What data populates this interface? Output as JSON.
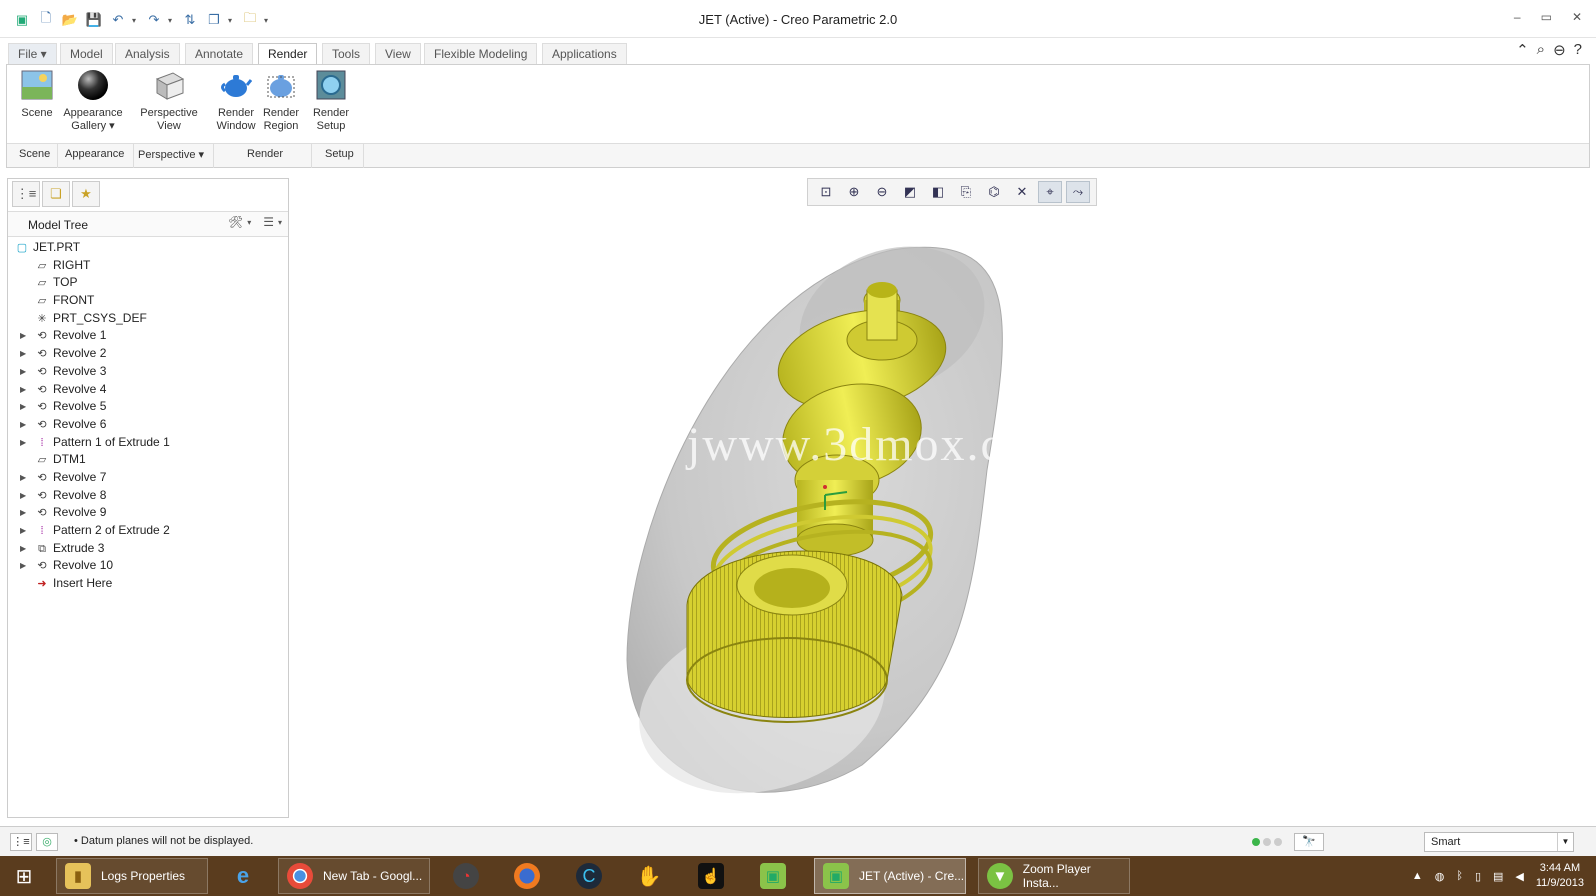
{
  "window": {
    "title": "JET (Active) - Creo Parametric 2.0",
    "controls": [
      "–",
      "▭",
      "✕"
    ]
  },
  "quick_access": {
    "icons": [
      "app-icon",
      "new-icon",
      "open-icon",
      "save-icon",
      "undo-icon",
      "redo-icon",
      "regenerate-icon",
      "windows-icon",
      "close-window-icon",
      "customize-icon"
    ]
  },
  "tabs": [
    {
      "label": "File ▾"
    },
    {
      "label": "Model"
    },
    {
      "label": "Analysis"
    },
    {
      "label": "Annotate"
    },
    {
      "label": "Render"
    },
    {
      "label": "Tools"
    },
    {
      "label": "View"
    },
    {
      "label": "Flexible Modeling"
    },
    {
      "label": "Applications"
    }
  ],
  "ribbon": {
    "buttons": [
      {
        "label": "Scene",
        "icon": "scene-icon"
      },
      {
        "label": "Appearance\nGallery ▾",
        "label1": "Appearance",
        "label2": "Gallery ▾",
        "icon": "appearance-ball-icon"
      },
      {
        "label1": "Perspective",
        "label2": "View",
        "icon": "perspective-cube-icon"
      },
      {
        "label1": "Render",
        "label2": "Window",
        "icon": "teapot-icon"
      },
      {
        "label1": "Render",
        "label2": "Region",
        "icon": "teapot-region-icon"
      },
      {
        "label1": "Render",
        "label2": "Setup",
        "icon": "render-setup-icon"
      }
    ],
    "groups": [
      "Scene",
      "Appearance",
      "Perspective ▾",
      "Render",
      "Setup"
    ]
  },
  "model_tree": {
    "title": "Model Tree",
    "items": [
      {
        "label": "JET.PRT",
        "icon": "part-icon",
        "expandable": false,
        "root": true
      },
      {
        "label": "RIGHT",
        "icon": "datum-plane-icon",
        "expandable": false
      },
      {
        "label": "TOP",
        "icon": "datum-plane-icon",
        "expandable": false
      },
      {
        "label": "FRONT",
        "icon": "datum-plane-icon",
        "expandable": false
      },
      {
        "label": "PRT_CSYS_DEF",
        "icon": "csys-icon",
        "expandable": false
      },
      {
        "label": "Revolve 1",
        "icon": "revolve-icon",
        "expandable": true
      },
      {
        "label": "Revolve 2",
        "icon": "revolve-icon",
        "expandable": true
      },
      {
        "label": "Revolve 3",
        "icon": "revolve-icon",
        "expandable": true
      },
      {
        "label": "Revolve 4",
        "icon": "revolve-icon",
        "expandable": true
      },
      {
        "label": "Revolve 5",
        "icon": "revolve-icon",
        "expandable": true
      },
      {
        "label": "Revolve 6",
        "icon": "revolve-icon",
        "expandable": true
      },
      {
        "label": "Pattern 1 of Extrude 1",
        "icon": "pattern-icon",
        "expandable": true
      },
      {
        "label": "DTM1",
        "icon": "datum-plane-icon",
        "expandable": false
      },
      {
        "label": "Revolve 7",
        "icon": "revolve-icon",
        "expandable": true
      },
      {
        "label": "Revolve 8",
        "icon": "revolve-icon",
        "expandable": true
      },
      {
        "label": "Revolve 9",
        "icon": "revolve-icon",
        "expandable": true
      },
      {
        "label": "Pattern 2 of Extrude 2",
        "icon": "pattern-icon",
        "expandable": true
      },
      {
        "label": "Extrude 3",
        "icon": "extrude-icon",
        "expandable": true
      },
      {
        "label": "Revolve 10",
        "icon": "revolve-icon",
        "expandable": true
      },
      {
        "label": "Insert Here",
        "icon": "insert-arrow-icon",
        "expandable": false
      }
    ]
  },
  "view_toolbar": [
    "refit-icon",
    "zoom-in-icon",
    "zoom-out-icon",
    "repaint-icon",
    "display-style-icon",
    "saved-views-icon",
    "view-manager-icon",
    "datum-display-icon",
    "spin-center-icon",
    "annotation-display-icon"
  ],
  "watermark": "www.3dmox.com",
  "watermark_visible": "jwww.3dmox.c",
  "status": {
    "message": "Datum planes will not be displayed.",
    "filter": "Smart"
  },
  "taskbar": {
    "items": [
      {
        "label": "Logs Properties",
        "icon": "folder-icon"
      },
      {
        "label": "",
        "icon": "ie-icon"
      },
      {
        "label": "New Tab - Googl...",
        "icon": "chrome-icon"
      },
      {
        "label": "",
        "icon": "speed-icon"
      },
      {
        "label": "",
        "icon": "firefox-icon"
      },
      {
        "label": "",
        "icon": "c-icon"
      },
      {
        "label": "",
        "icon": "hand-icon"
      },
      {
        "label": "",
        "icon": "cursor-icon"
      },
      {
        "label": "",
        "icon": "creo-icon"
      },
      {
        "label": "JET (Active) - Cre...",
        "icon": "creo-icon"
      },
      {
        "label": "Zoom Player Insta...",
        "icon": "zoom-player-icon"
      }
    ],
    "time": "3:44 AM",
    "date": "11/9/2013"
  }
}
